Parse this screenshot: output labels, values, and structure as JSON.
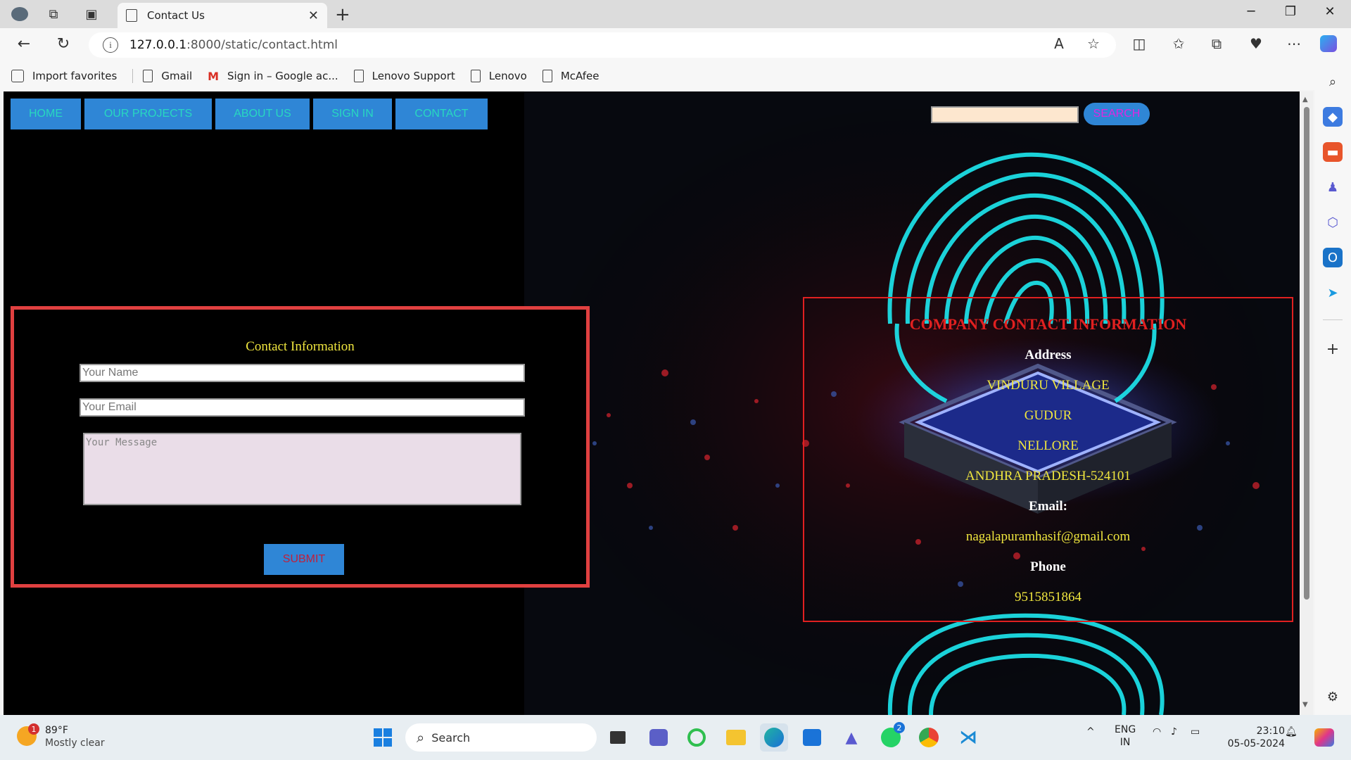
{
  "browser": {
    "tab_title": "Contact Us",
    "url_host": "127.0.0.1",
    "url_path": ":8000/static/contact.html",
    "favorites": [
      "Import favorites",
      "Gmail",
      "Sign in – Google ac...",
      "Lenovo Support",
      "Lenovo",
      "McAfee"
    ]
  },
  "nav": {
    "items": [
      "HOME",
      "OUR PROJECTS",
      "ABOUT US",
      "SIGN IN",
      "CONTACT"
    ],
    "search_button": "SEARCH",
    "search_value": ""
  },
  "contact_form": {
    "title": "Contact Information",
    "name_placeholder": "Your Name",
    "email_placeholder": "Your Email",
    "message_placeholder": "Your Message",
    "submit_label": "SUBMIT"
  },
  "company": {
    "title": "COMPANY CONTACT INFORMATION",
    "address_label": "Address",
    "address_lines": [
      "VINDURU VILLAGE",
      "GUDUR",
      "NELLORE",
      "ANDHRA PRADESH-524101"
    ],
    "email_label": "Email:",
    "email": "nagalapuramhasif@gmail.com",
    "phone_label": "Phone",
    "phone": "9515851864"
  },
  "taskbar": {
    "weather_badge": "1",
    "temperature": "89°F",
    "condition": "Mostly clear",
    "search_label": "Search",
    "whatsapp_badge": "2",
    "lang": "ENG",
    "region": "IN",
    "time": "23:10",
    "date": "05-05-2024"
  },
  "colors": {
    "nav_bg": "#2f86d6",
    "nav_text": "#28d8c0",
    "form_border": "#e04040",
    "accent_yellow": "#f0e63e",
    "company_title": "#e02020"
  }
}
